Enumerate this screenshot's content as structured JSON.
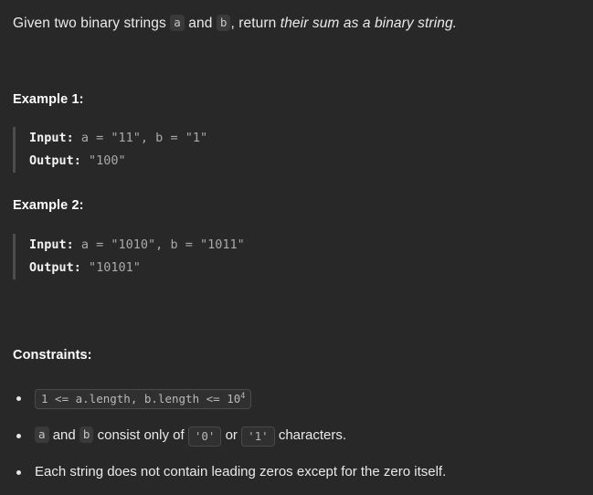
{
  "theme": {
    "background": "#282828",
    "text": "#eaeaea",
    "heading": "#ffffff",
    "code_text": "#a9a9a9",
    "code_label": "#f2f2f2",
    "chip_bg": "#3a3a3a",
    "chip_border": "#4a4a4a",
    "block_border": "#4d4d4d",
    "number": "#d0c089"
  },
  "problem": {
    "description": {
      "prefix": "Given two binary strings ",
      "var_a": "a",
      "between": " and ",
      "var_b": "b",
      "middle": ", return ",
      "emphasis": "their sum as a binary string."
    },
    "examples": [
      {
        "heading": "Example 1:",
        "input_label": "Input:",
        "input_value": " a = \"11\", b = \"1\"",
        "output_label": "Output:",
        "output_value": " \"100\""
      },
      {
        "heading": "Example 2:",
        "input_label": "Input:",
        "input_value": " a = \"1010\", b = \"1011\"",
        "output_label": "Output:",
        "output_value": " \"10101\""
      }
    ],
    "constraints": {
      "heading": "Constraints:",
      "items": [
        {
          "type": "code",
          "code_prefix": "1 <= a.length, b.length <= 10",
          "code_superscript": "4"
        },
        {
          "type": "mixed",
          "var_a": "a",
          "text_1": " and ",
          "var_b": "b",
          "text_2": " consist only of ",
          "code_zero": "'0'",
          "text_3": " or ",
          "code_one": "'1'",
          "text_4": " characters."
        },
        {
          "type": "text",
          "text": "Each string does not contain leading zeros except for the zero itself."
        }
      ]
    }
  }
}
